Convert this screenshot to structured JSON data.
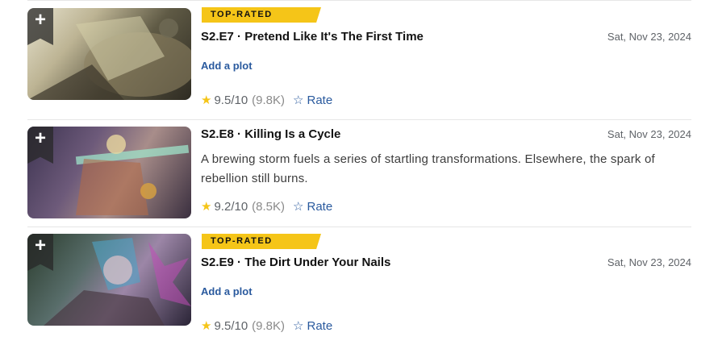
{
  "episodes": [
    {
      "badge": "TOP-RATED",
      "title": "S2.E7 · Pretend Like It's The First Time",
      "date": "Sat, Nov 23, 2024",
      "add_plot": "Add a plot",
      "rating": "9.5",
      "rating_denominator": "/10",
      "vote_count": "(9.8K)",
      "rate_label": "Rate",
      "watchlist_symbol": "+"
    },
    {
      "title": "S2.E8 · Killing Is a Cycle",
      "date": "Sat, Nov 23, 2024",
      "plot": "A brewing storm fuels a series of startling transformations. Elsewhere, the spark of rebellion still burns.",
      "rating": "9.2",
      "rating_denominator": "/10",
      "vote_count": "(8.5K)",
      "rate_label": "Rate",
      "watchlist_symbol": "+"
    },
    {
      "badge": "TOP-RATED",
      "title": "S2.E9 · The Dirt Under Your Nails",
      "date": "Sat, Nov 23, 2024",
      "add_plot": "Add a plot",
      "rating": "9.5",
      "rating_denominator": "/10",
      "vote_count": "(9.8K)",
      "rate_label": "Rate",
      "watchlist_symbol": "+"
    }
  ],
  "colors": {
    "badge": "#f5c518",
    "link": "#2a5a9e",
    "star": "#f5c518"
  },
  "icons": {
    "rating_star": "★",
    "rate_star": "☆"
  }
}
